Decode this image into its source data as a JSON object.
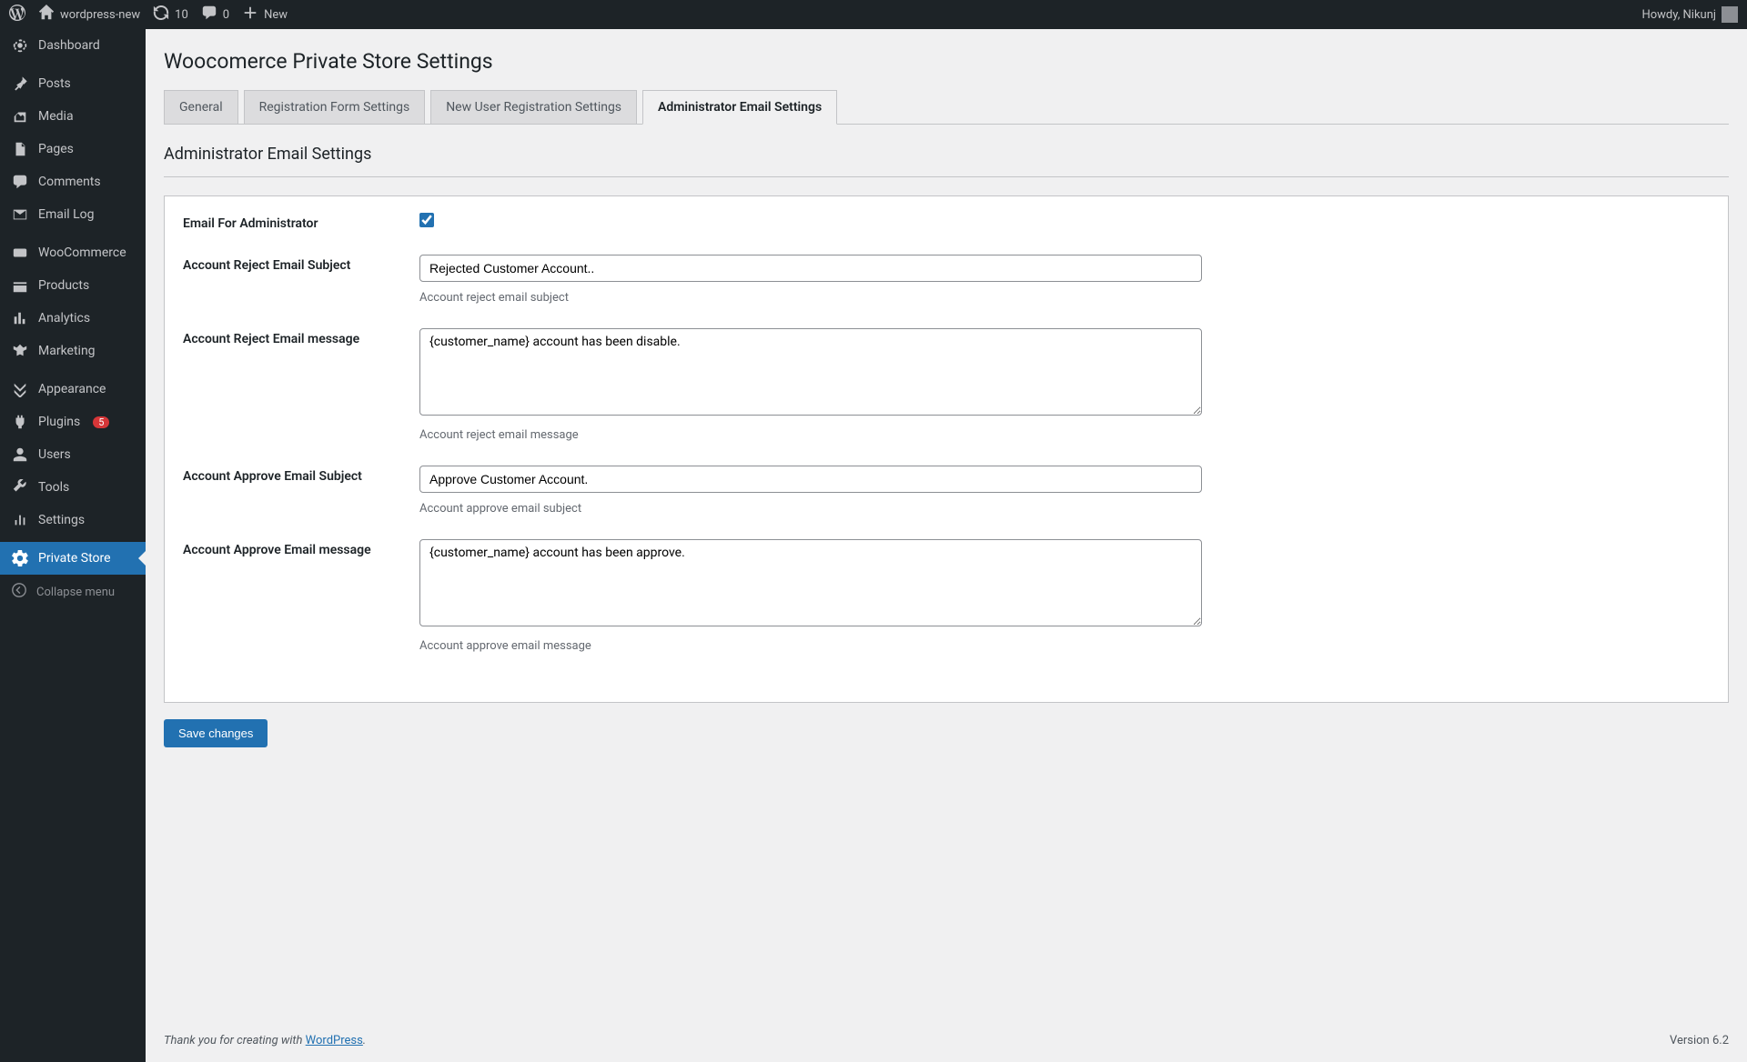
{
  "adminbar": {
    "site_name": "wordpress-new",
    "updates_count": "10",
    "comments_count": "0",
    "new_label": "New",
    "howdy": "Howdy, Nikunj"
  },
  "sidebar": {
    "items": [
      {
        "label": "Dashboard",
        "icon": "dashboard"
      },
      {
        "label": "Posts",
        "icon": "pin"
      },
      {
        "label": "Media",
        "icon": "media"
      },
      {
        "label": "Pages",
        "icon": "pages"
      },
      {
        "label": "Comments",
        "icon": "comment"
      },
      {
        "label": "Email Log",
        "icon": "email"
      },
      {
        "label": "WooCommerce",
        "icon": "woo"
      },
      {
        "label": "Products",
        "icon": "products"
      },
      {
        "label": "Analytics",
        "icon": "analytics"
      },
      {
        "label": "Marketing",
        "icon": "marketing"
      },
      {
        "label": "Appearance",
        "icon": "appearance"
      },
      {
        "label": "Plugins",
        "icon": "plugins",
        "badge": "5"
      },
      {
        "label": "Users",
        "icon": "users"
      },
      {
        "label": "Tools",
        "icon": "tools"
      },
      {
        "label": "Settings",
        "icon": "settings"
      },
      {
        "label": "Private Store",
        "icon": "gear",
        "current": true
      }
    ],
    "collapse_label": "Collapse menu"
  },
  "page": {
    "title": "Woocomerce Private Store Settings",
    "section_title": "Administrator Email Settings"
  },
  "tabs": [
    {
      "label": "General"
    },
    {
      "label": "Registration Form Settings"
    },
    {
      "label": "New User Registration Settings"
    },
    {
      "label": "Administrator Email Settings",
      "active": true
    }
  ],
  "form": {
    "fields": {
      "email_for_admin": {
        "label": "Email For Administrator",
        "checked": true
      },
      "reject_subject": {
        "label": "Account Reject Email Subject",
        "value": "Rejected Customer Account..",
        "help": "Account reject email subject"
      },
      "reject_message": {
        "label": "Account Reject Email message",
        "value": "{customer_name} account has been disable.",
        "help": "Account reject email message"
      },
      "approve_subject": {
        "label": "Account Approve Email Subject",
        "value": "Approve Customer Account.",
        "help": "Account approve email subject"
      },
      "approve_message": {
        "label": "Account Approve Email message",
        "value": "{customer_name} account has been approve.",
        "help": "Account approve email message"
      }
    },
    "save_label": "Save changes"
  },
  "footer": {
    "thanks_prefix": "Thank you for creating with ",
    "thanks_link": "WordPress",
    "version": "Version 6.2"
  }
}
